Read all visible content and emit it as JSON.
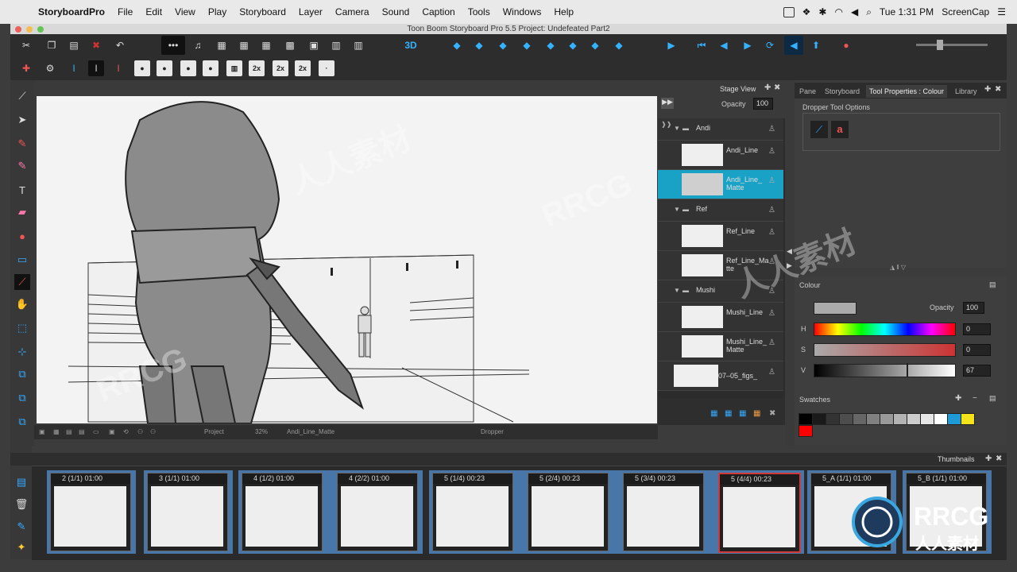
{
  "menubar": {
    "app": "StoryboardPro",
    "items": [
      "File",
      "Edit",
      "View",
      "Play",
      "Storyboard",
      "Layer",
      "Camera",
      "Sound",
      "Caption",
      "Tools",
      "Windows",
      "Help"
    ],
    "clock": "Tue 1:31 PM",
    "user": "ScreenCap"
  },
  "window": {
    "title": "Toon Boom Storyboard Pro 5.5 Project: Undefeated Part2"
  },
  "toolbar": {
    "chips": [
      "2x",
      "2x",
      "2x"
    ]
  },
  "stage": {
    "panel_title": "Stage View",
    "opacity_label": "Opacity",
    "opacity_value": "100",
    "status": {
      "project": "Project",
      "zoom": "32%",
      "layer": "Andi_Line_Matte",
      "tool": "Dropper"
    }
  },
  "layers": [
    {
      "type": "group",
      "name": "Andi"
    },
    {
      "type": "layer",
      "name": "Andi_Line"
    },
    {
      "type": "layer",
      "name": "Andi_Line_\nMatte",
      "selected": true
    },
    {
      "type": "group",
      "name": "Ref"
    },
    {
      "type": "layer",
      "name": "Ref_Line"
    },
    {
      "type": "layer",
      "name": "Ref_Line_Ma\ntte"
    },
    {
      "type": "group",
      "name": "Mushi"
    },
    {
      "type": "layer",
      "name": "Mushi_Line"
    },
    {
      "type": "layer",
      "name": "Mushi_Line_\nMatte"
    },
    {
      "type": "layer",
      "name": "07–05_figs_"
    }
  ],
  "toolprops": {
    "tabs": [
      "Pane",
      "Storyboard",
      "Tool Properties : Colour",
      "Library"
    ],
    "title": "Dropper Tool Options"
  },
  "colour": {
    "section": "Colour",
    "opacity_label": "Opacity",
    "opacity": "100",
    "h_label": "H",
    "h": "0",
    "s_label": "S",
    "s": "0",
    "v_label": "V",
    "v": "67",
    "swatches_label": "Swatches",
    "swatch_colors": [
      "#000000",
      "#1a1a1a",
      "#333333",
      "#4d4d4d",
      "#666666",
      "#808080",
      "#999999",
      "#b3b3b3",
      "#cccccc",
      "#e6e6e6",
      "#ffffff",
      "#1e9ad6",
      "#f4e21b",
      "#ff0000"
    ]
  },
  "thumbnails": {
    "title": "Thumbnails",
    "panels": [
      {
        "label": "2 (1/1) 01:00"
      },
      {
        "label": "3 (1/1) 01:00"
      },
      {
        "label": "4 (1/2) 01:00"
      },
      {
        "label": "4 (2/2) 01:00"
      },
      {
        "label": "5 (1/4) 00:23"
      },
      {
        "label": "5 (2/4) 00:23"
      },
      {
        "label": "5 (3/4) 00:23"
      },
      {
        "label": "5 (4/4) 00:23",
        "selected": true
      },
      {
        "label": "5_A (1/1) 01:00"
      },
      {
        "label": "5_B (1/1) 01:00"
      }
    ]
  },
  "watermark": {
    "text1": "RRCG",
    "text2": "人人素材"
  }
}
